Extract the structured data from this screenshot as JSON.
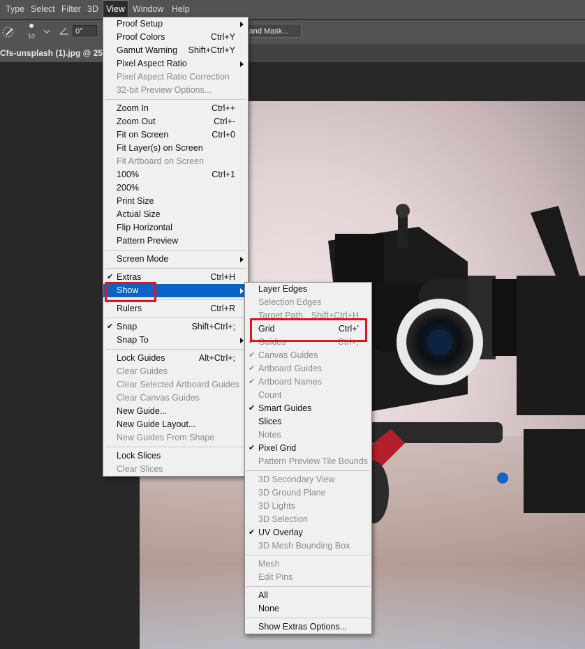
{
  "menubar": {
    "items": [
      "Type",
      "Select",
      "Filter",
      "3D",
      "View",
      "Window",
      "Help"
    ],
    "active": "View"
  },
  "options": {
    "brush_size": "10",
    "angle": "0°",
    "select_mask_label": "ct and Mask..."
  },
  "document": {
    "tab_title": "Cfs-unsplash (1).jpg @ 25% ("
  },
  "view_menu": {
    "groups": [
      [
        {
          "label": "Proof Setup",
          "submenu": true
        },
        {
          "label": "Proof Colors",
          "shortcut": "Ctrl+Y"
        },
        {
          "label": "Gamut Warning",
          "shortcut": "Shift+Ctrl+Y"
        },
        {
          "label": "Pixel Aspect Ratio",
          "submenu": true
        },
        {
          "label": "Pixel Aspect Ratio Correction",
          "disabled": true
        },
        {
          "label": "32-bit Preview Options...",
          "disabled": true
        }
      ],
      [
        {
          "label": "Zoom In",
          "shortcut": "Ctrl++"
        },
        {
          "label": "Zoom Out",
          "shortcut": "Ctrl+-"
        },
        {
          "label": "Fit on Screen",
          "shortcut": "Ctrl+0"
        },
        {
          "label": "Fit Layer(s) on Screen"
        },
        {
          "label": "Fit Artboard on Screen",
          "disabled": true
        },
        {
          "label": "100%",
          "shortcut": "Ctrl+1"
        },
        {
          "label": "200%"
        },
        {
          "label": "Print Size"
        },
        {
          "label": "Actual Size"
        },
        {
          "label": "Flip Horizontal"
        },
        {
          "label": "Pattern Preview"
        }
      ],
      [
        {
          "label": "Screen Mode",
          "submenu": true
        }
      ],
      [
        {
          "label": "Extras",
          "shortcut": "Ctrl+H",
          "checked": true
        },
        {
          "label": "Show",
          "submenu": true,
          "highlight": true
        }
      ],
      [
        {
          "label": "Rulers",
          "shortcut": "Ctrl+R"
        }
      ],
      [
        {
          "label": "Snap",
          "shortcut": "Shift+Ctrl+;",
          "checked": true
        },
        {
          "label": "Snap To",
          "submenu": true
        }
      ],
      [
        {
          "label": "Lock Guides",
          "shortcut": "Alt+Ctrl+;"
        },
        {
          "label": "Clear Guides",
          "disabled": true
        },
        {
          "label": "Clear Selected Artboard Guides",
          "disabled": true
        },
        {
          "label": "Clear Canvas Guides",
          "disabled": true
        },
        {
          "label": "New Guide..."
        },
        {
          "label": "New Guide Layout..."
        },
        {
          "label": "New Guides From Shape",
          "disabled": true
        }
      ],
      [
        {
          "label": "Lock Slices"
        },
        {
          "label": "Clear Slices",
          "disabled": true
        }
      ]
    ]
  },
  "show_menu": {
    "groups": [
      [
        {
          "label": "Layer Edges"
        },
        {
          "label": "Selection Edges",
          "disabled": true
        },
        {
          "label": "Target Path",
          "shortcut": "Shift+Ctrl+H",
          "disabled": true
        },
        {
          "label": "Grid",
          "shortcut": "Ctrl+'"
        },
        {
          "label": "Guides",
          "shortcut": "Ctrl+;",
          "checked": true,
          "disabled": true
        },
        {
          "label": "Canvas Guides",
          "checked": true,
          "disabled": true
        },
        {
          "label": "Artboard Guides",
          "checked": true,
          "disabled": true
        },
        {
          "label": "Artboard Names",
          "checked": true,
          "disabled": true
        },
        {
          "label": "Count",
          "disabled": true
        },
        {
          "label": "Smart Guides",
          "checked": true
        },
        {
          "label": "Slices"
        },
        {
          "label": "Notes",
          "disabled": true
        },
        {
          "label": "Pixel Grid",
          "checked": true
        },
        {
          "label": "Pattern Preview Tile Bounds",
          "disabled": true
        }
      ],
      [
        {
          "label": "3D Secondary View",
          "disabled": true
        },
        {
          "label": "3D Ground Plane",
          "disabled": true
        },
        {
          "label": "3D Lights",
          "disabled": true
        },
        {
          "label": "3D Selection",
          "disabled": true
        },
        {
          "label": "UV Overlay",
          "checked": true
        },
        {
          "label": "3D Mesh Bounding Box",
          "disabled": true
        }
      ],
      [
        {
          "label": "Mesh",
          "disabled": true
        },
        {
          "label": "Edit Pins",
          "disabled": true
        }
      ],
      [
        {
          "label": "All"
        },
        {
          "label": "None"
        }
      ],
      [
        {
          "label": "Show Extras Options..."
        }
      ]
    ]
  },
  "colors": {
    "menubar_bg": "#535353",
    "menu_bg": "#f0f0f0",
    "highlight": "#0a64c8",
    "annotation_red": "#e0141e"
  }
}
